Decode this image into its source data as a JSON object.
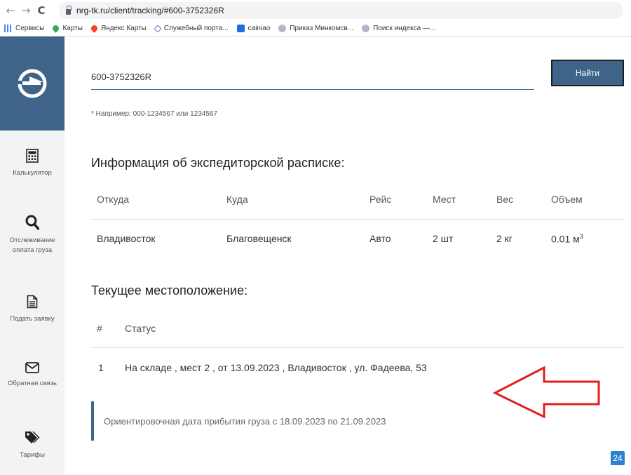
{
  "browser": {
    "url": "nrg-tk.ru/client/tracking/#600-3752326R",
    "bookmarks": [
      "Сервисы",
      "Карты",
      "Яндекс Карты",
      "Служебный порта...",
      "cainiao",
      "Приказ Минкомсв...",
      "Поиск индекса —..."
    ]
  },
  "sidebar": {
    "items": [
      {
        "label": "Калькулятор",
        "icon": "calculator-icon"
      },
      {
        "label_line1": "Отслеживание",
        "label_line2": "оплата груза",
        "icon": "search-icon"
      },
      {
        "label": "Подать заявку",
        "icon": "document-icon"
      },
      {
        "label": "Обратная связь",
        "icon": "envelope-icon"
      },
      {
        "label": "Тарифы",
        "icon": "tags-icon"
      }
    ]
  },
  "search": {
    "value": "600-3752326R",
    "button_label": "Найти",
    "example": "* Например: 000-1234567 или 1234567"
  },
  "info": {
    "heading": "Информация об экспедиторской расписке:",
    "headers": [
      "Откуда",
      "Куда",
      "Рейс",
      "Мест",
      "Вес",
      "Объем"
    ],
    "row": {
      "from": "Владивосток",
      "to": "Благовещенск",
      "trip": "Авто",
      "places": "2 шт",
      "weight": "2 кг",
      "volume": "0.01 м",
      "volume_sup": "3"
    }
  },
  "location": {
    "heading": "Текущее местоположение:",
    "headers": [
      "#",
      "Статус"
    ],
    "rows": [
      {
        "num": "1",
        "status": "На складе , мест 2 , от 13.09.2023 , Владивосток , ул. Фадеева, 53"
      }
    ]
  },
  "note": "Ориентировочная дата прибытия груза с 18.09.2023 по 21.09.2023",
  "badge": "24",
  "colors": {
    "accent": "#3e6489",
    "arrow": "#e0201b"
  }
}
